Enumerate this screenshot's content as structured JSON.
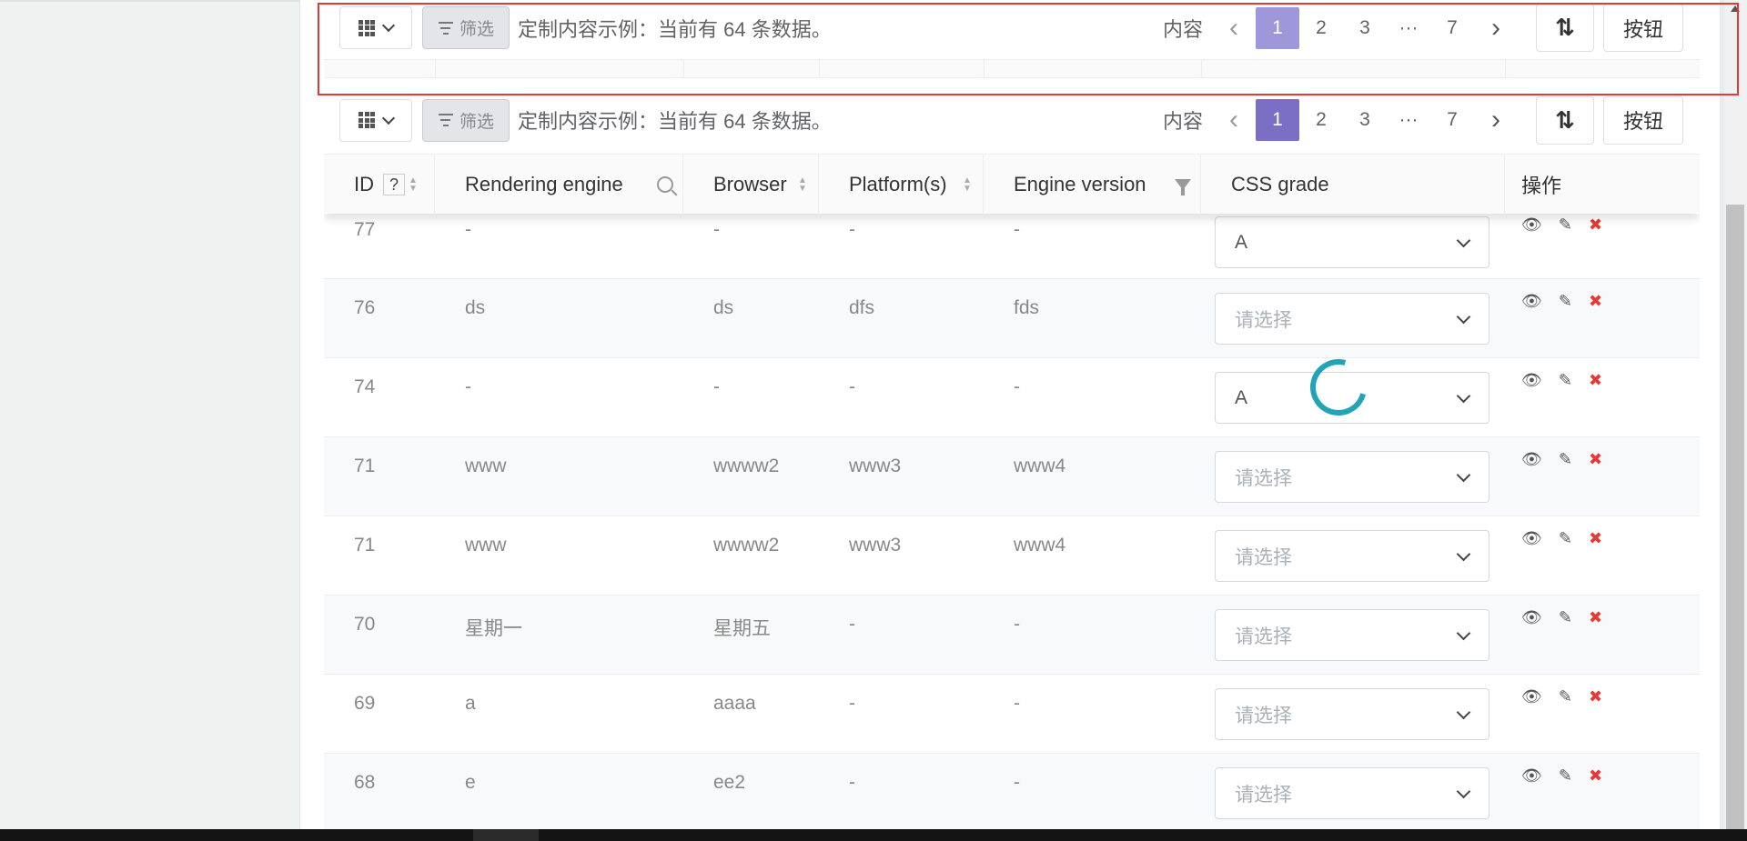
{
  "toolbar": {
    "filter_label": "筛选",
    "summary_text": "定制内容示例：当前有 64 条数据。",
    "pager_label": "内容",
    "pages": [
      "1",
      "2",
      "3",
      "···",
      "7"
    ],
    "active_page": "1",
    "prev_symbol": "‹",
    "next_symbol": "›",
    "sort_symbol": "⇅",
    "button_label": "按钮"
  },
  "table": {
    "headers": {
      "id": "ID",
      "help": "?",
      "rendering_engine": "Rendering engine",
      "browser": "Browser",
      "platforms": "Platform(s)",
      "engine_version": "Engine version",
      "css_grade": "CSS grade",
      "actions": "操作"
    },
    "select_placeholder": "请选择",
    "rows": [
      {
        "id": "77",
        "engine": "-",
        "browser": "-",
        "platform": "-",
        "version": "-",
        "grade": "A"
      },
      {
        "id": "76",
        "engine": "ds",
        "browser": "ds",
        "platform": "dfs",
        "version": "fds",
        "grade": ""
      },
      {
        "id": "74",
        "engine": "-",
        "browser": "-",
        "platform": "-",
        "version": "-",
        "grade": "A"
      },
      {
        "id": "71",
        "engine": "www",
        "browser": "wwww2",
        "platform": "www3",
        "version": "www4",
        "grade": ""
      },
      {
        "id": "71",
        "engine": "www",
        "browser": "wwww2",
        "platform": "www3",
        "version": "www4",
        "grade": ""
      },
      {
        "id": "70",
        "engine": "星期一",
        "browser": "星期五",
        "platform": "-",
        "version": "-",
        "grade": ""
      },
      {
        "id": "69",
        "engine": "a",
        "browser": "aaaa",
        "platform": "-",
        "version": "-",
        "grade": ""
      },
      {
        "id": "68",
        "engine": "e",
        "browser": "ee2",
        "platform": "-",
        "version": "-",
        "grade": ""
      }
    ]
  },
  "colors": {
    "accent": "#7a6fc4",
    "spinner": "#23a3b8",
    "delete": "#e53935",
    "highlight": "#e53935"
  },
  "icons": {
    "columns": "grid-icon",
    "filter": "filter-icon",
    "view": "eye-icon",
    "edit": "pencil-icon",
    "delete": "close-icon",
    "loading": "spinner-icon"
  }
}
